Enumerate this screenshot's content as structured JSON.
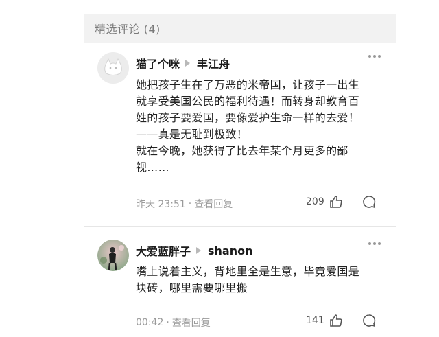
{
  "header": {
    "title": "精选评论 (4)"
  },
  "comments": [
    {
      "author": "猫了个咪",
      "reply_to": "丰江舟",
      "lines": [
        "她把孩子生在了万恶的米帝国，让孩子一出生",
        "就享受美国公民的福利待遇！而转身却教育百",
        "姓的孩子要爱国，要像爱护生命一样的去爱！",
        "——真是无耻到极致！",
        "就在今晚，她获得了比去年某个月更多的鄙",
        "视……"
      ],
      "time": "昨天 23:51",
      "separator": "·",
      "view_replies": "查看回复",
      "likes": "209",
      "avatar_icon": "cat-avatar-icon"
    },
    {
      "author": "大爱蓝胖子",
      "reply_to": "shanon",
      "lines": [
        "嘴上说着主义，背地里全是生意，毕竟爱国是",
        "块砖，哪里需要哪里搬"
      ],
      "time": "00:42",
      "separator": "·",
      "view_replies": "查看回复",
      "likes": "141",
      "avatar_icon": "person-photo-avatar"
    }
  ],
  "colors": {
    "header_bg": "#f2f2f2",
    "muted": "#9a9a9a",
    "text": "#222222"
  }
}
